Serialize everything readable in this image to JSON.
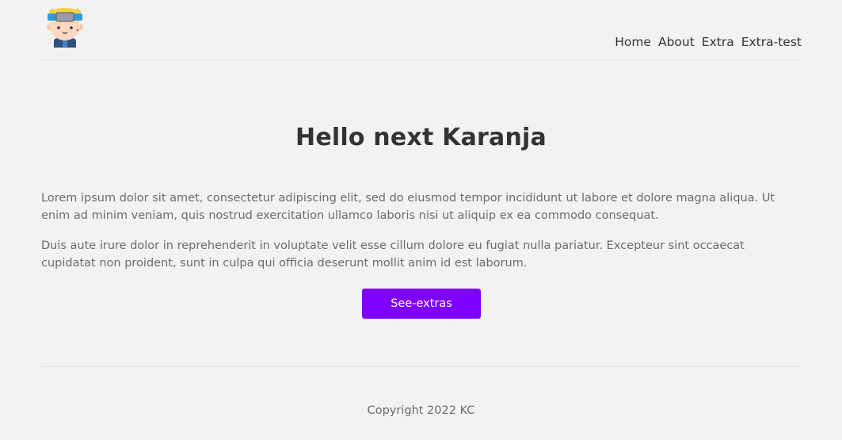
{
  "header": {
    "logo_icon": "ninja-avatar-icon",
    "nav": [
      {
        "label": "Home"
      },
      {
        "label": "About"
      },
      {
        "label": "Extra"
      },
      {
        "label": "Extra-test"
      }
    ]
  },
  "main": {
    "title": "Hello next Karanja",
    "paragraph_1": "Lorem ipsum dolor sit amet, consectetur adipiscing elit, sed do eiusmod tempor incididunt ut labore et dolore magna aliqua. Ut enim ad minim veniam, quis nostrud exercitation ullamco laboris nisi ut aliquip ex ea commodo consequat.",
    "paragraph_2": "Duis aute irure dolor in reprehenderit in voluptate velit esse cillum dolore eu fugiat nulla pariatur. Excepteur sint occaecat cupidatat non proident, sunt in culpa qui officia deserunt mollit anim id est laborum.",
    "button_label": "See-extras"
  },
  "footer": {
    "copyright": "Copyright 2022 KC"
  },
  "colors": {
    "accent": "#7f00ff",
    "background": "#f2f2f2"
  }
}
